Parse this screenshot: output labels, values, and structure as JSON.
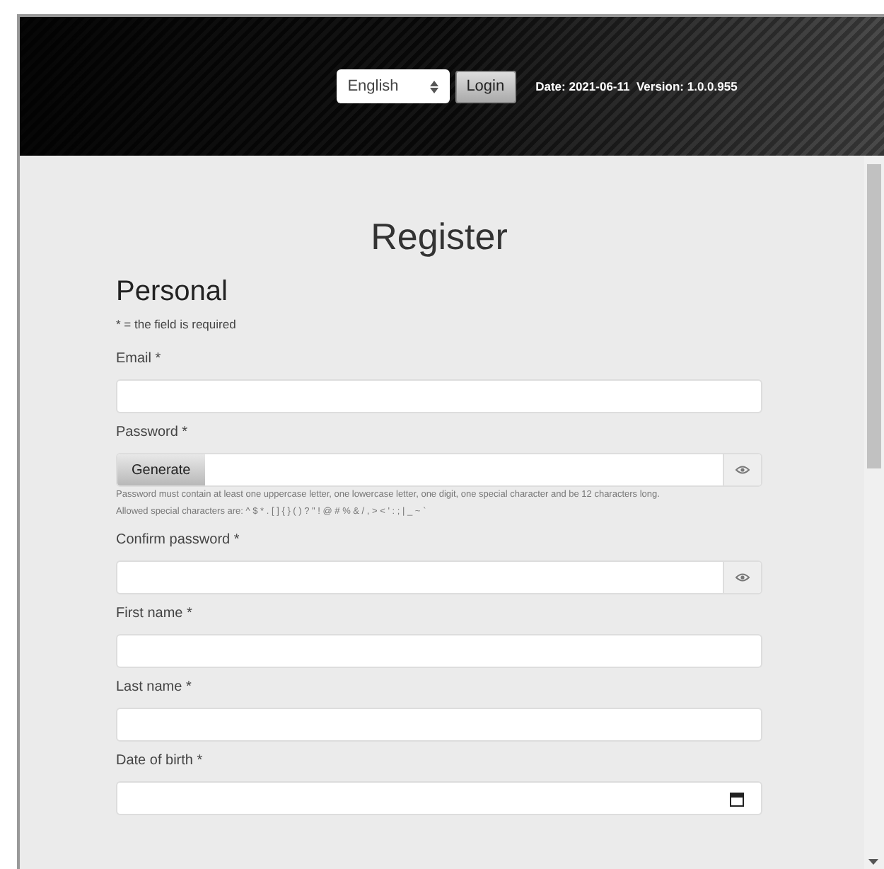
{
  "header": {
    "language": "English",
    "login_button": "Login",
    "date_label": "Date:",
    "date": "2021-06-11",
    "version_label": "Version:",
    "version": "1.0.0.955"
  },
  "title": "Register",
  "section": "Personal",
  "required_note": "* = the field is required",
  "fields": [
    {
      "kind": "text",
      "label": "Email *"
    },
    {
      "kind": "generate",
      "label": "Password *",
      "button": "Generate",
      "help": [
        "Password must contain at least one uppercase letter, one lowercase letter, one digit, one special character and be 12 characters long.",
        "Allowed special characters are: ^ $ * . [ ] { } ( ) ? \" ! @ # % & / , > < ' : ; | _ ~ `"
      ]
    },
    {
      "kind": "password",
      "label": "Confirm password *"
    },
    {
      "kind": "text",
      "label": "First name *"
    },
    {
      "kind": "text",
      "label": "Last name *"
    },
    {
      "kind": "date",
      "label": "Date of birth *"
    }
  ]
}
